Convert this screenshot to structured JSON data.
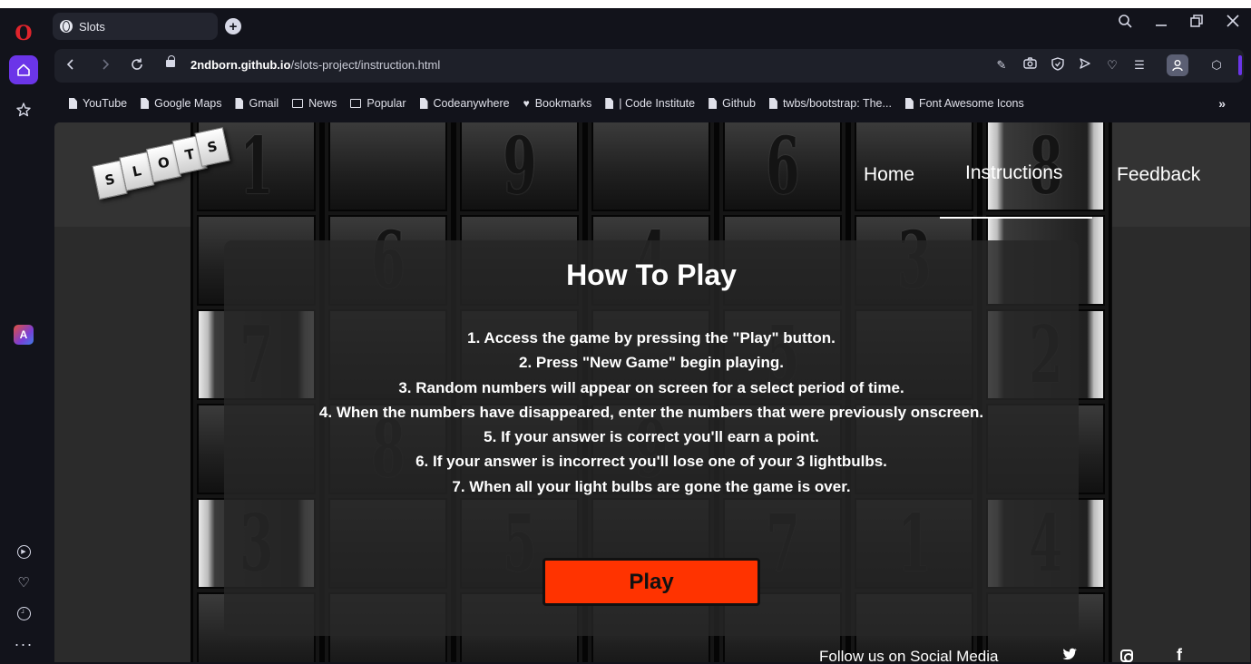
{
  "browser": {
    "tab_title": "Slots",
    "new_tab": "+",
    "url_domain": "2ndborn.github.io",
    "url_path": "/slots-project/instruction.html",
    "bookmarks": [
      "YouTube",
      "Google Maps",
      "Gmail",
      "News",
      "Popular",
      "Codeanywhere",
      "Bookmarks",
      "| Code Institute",
      "Github",
      "twbs/bootstrap: The...",
      "Font Awesome Icons"
    ],
    "bookmarks_more": "»",
    "accent_color": "#6b35e8"
  },
  "page": {
    "logo_letters": [
      "S",
      "L",
      "O",
      "T",
      "S"
    ],
    "nav": {
      "home": "Home",
      "instructions": "Instructions",
      "feedback": "Feedback",
      "active": "Instructions"
    },
    "reel_numbers": [
      "1",
      "6",
      "7",
      "8",
      "3",
      "9",
      "4",
      "5",
      "9",
      "5",
      "6",
      "7",
      "3",
      "1",
      "8",
      "2",
      "4"
    ],
    "heading": "How To Play",
    "steps": [
      "1. Access the game by pressing the \"Play\" button.",
      "2. Press \"New Game\" begin playing.",
      "3. Random numbers will appear on screen for a select period of time.",
      "4. When the numbers have disappeared, enter the numbers that were previously onscreen.",
      "5. If your answer is correct you'll earn a point.",
      "6. If your answer is incorrect you'll lose one of your 3 lightbulbs.",
      "7. When all your light bulbs are gone the game is over."
    ],
    "play_label": "Play",
    "play_color": "#ff3300",
    "footer_text": "Follow us on Social Media",
    "social_icons": [
      "twitter-icon",
      "instagram-icon",
      "facebook-icon"
    ]
  }
}
